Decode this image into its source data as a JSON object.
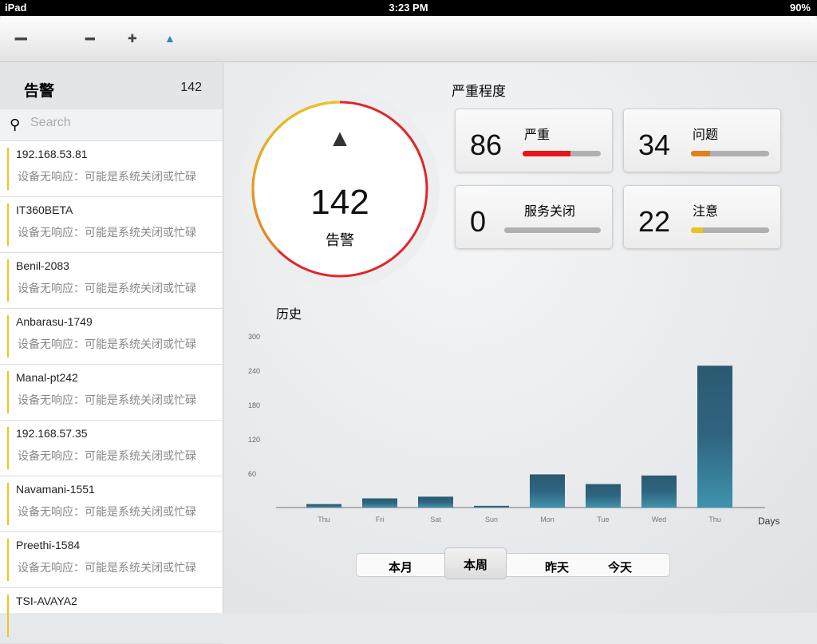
{
  "status": {
    "device": "iPad",
    "time": "3:23 PM",
    "battery": "90%"
  },
  "toolbar": {
    "icons": [
      "list-grid-icon",
      "grid-icon",
      "cross-icon",
      "alarm-tree-icon"
    ]
  },
  "sidebar": {
    "title": "告警",
    "count": "142",
    "search_placeholder": "Search",
    "items": [
      {
        "name": "192.168.53.81",
        "desc": "设备无响应：可能是系统关闭或忙碌"
      },
      {
        "name": "IT360BETA",
        "desc": "设备无响应：可能是系统关闭或忙碌"
      },
      {
        "name": "Benil-2083",
        "desc": "设备无响应：可能是系统关闭或忙碌"
      },
      {
        "name": "Anbarasu-1749",
        "desc": "设备无响应：可能是系统关闭或忙碌"
      },
      {
        "name": "Manal-pt242",
        "desc": "设备无响应：可能是系统关闭或忙碌"
      },
      {
        "name": "192.168.57.35",
        "desc": "设备无响应：可能是系统关闭或忙碌"
      },
      {
        "name": "Navamani-1551",
        "desc": "设备无响应：可能是系统关闭或忙碌"
      },
      {
        "name": "Preethi-1584",
        "desc": "设备无响应：可能是系统关闭或忙碌"
      },
      {
        "name": "TSI-AVAYA2",
        "desc": ""
      }
    ]
  },
  "summary": {
    "total": "142",
    "label": "告警"
  },
  "severity": {
    "title": "严重程度",
    "cards": [
      {
        "value": "86",
        "label": "严重",
        "fraction": 0.61,
        "color": "#e8141b"
      },
      {
        "value": "34",
        "label": "问题",
        "fraction": 0.24,
        "color": "#e0821a"
      },
      {
        "value": "0",
        "label": "服务关闭",
        "fraction": 0,
        "color": "#999999"
      },
      {
        "value": "22",
        "label": "注意",
        "fraction": 0.15,
        "color": "#e6c619"
      }
    ]
  },
  "history": {
    "title": "历史"
  },
  "chart_data": {
    "type": "bar",
    "categories": [
      "Thu",
      "Fri",
      "Sat",
      "Sun",
      "Mon",
      "Tue",
      "Wed",
      "Thu"
    ],
    "values": [
      6,
      16,
      19,
      3,
      58,
      41,
      56,
      248
    ],
    "xlabel": "Days",
    "ylabel": "",
    "ylim": [
      0,
      300
    ],
    "yticks": [
      60,
      120,
      180,
      240,
      300
    ]
  },
  "segments": {
    "month": "本月",
    "week": "本周",
    "yesterday": "昨天",
    "today": "今天"
  }
}
